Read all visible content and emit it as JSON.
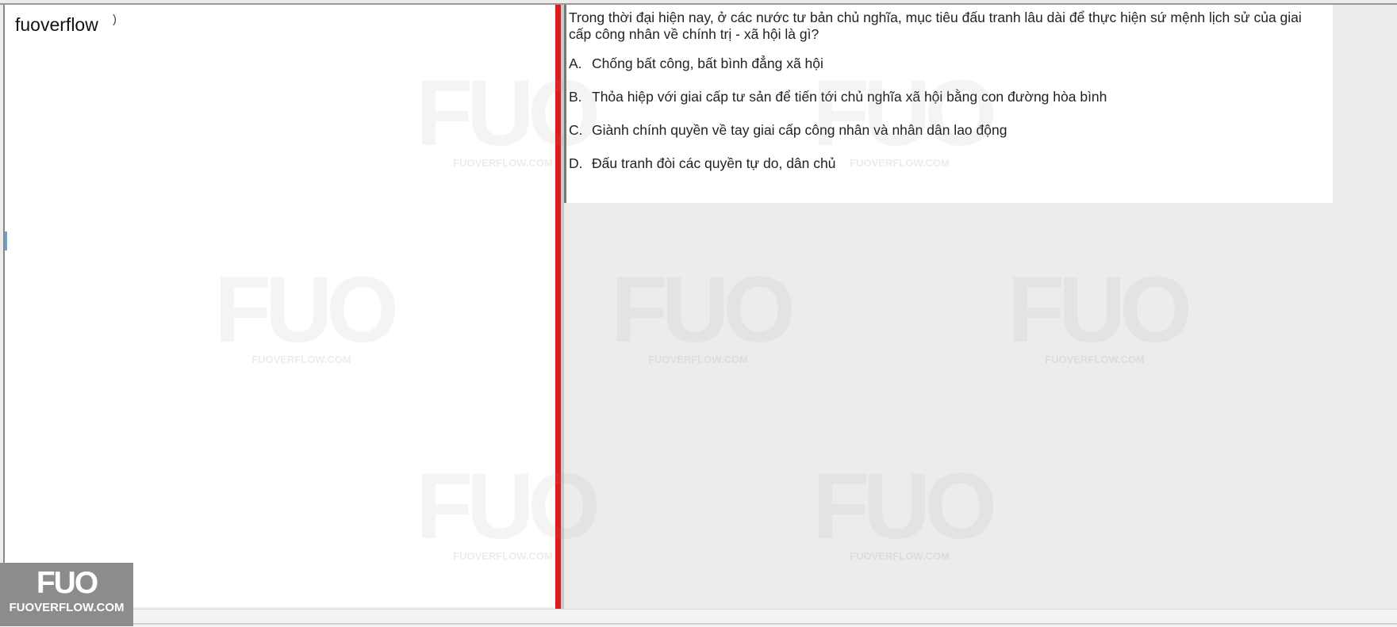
{
  "left_pane": {
    "title": "fuoverflow",
    "mark": ")"
  },
  "question": {
    "text": "Trong thời đại hiện nay, ở các nước tư bản chủ nghĩa, mục tiêu đấu tranh lâu dài để thực hiện sứ mệnh lịch sử của giai cấp công nhân về chính trị - xã hội là gì?",
    "options": [
      {
        "letter": "A.",
        "text": "Chống bất công, bất bình đẳng xã hội"
      },
      {
        "letter": "B.",
        "text": "Thỏa hiệp với giai cấp tư sản để tiến tới chủ nghĩa xã hội bằng con đường hòa bình"
      },
      {
        "letter": "C.",
        "text": "Giành chính quyền về tay giai cấp công nhân và nhân dân lao động"
      },
      {
        "letter": "D.",
        "text": "Đấu tranh đòi các quyền tự do, dân chủ"
      }
    ]
  },
  "watermark": {
    "logo_text": "FUO",
    "site_text": "FUOVERFLOW.COM"
  },
  "badge": {
    "logo_text": "FUO",
    "site_text": "FUOVERFLOW.COM"
  },
  "colors": {
    "divider": "#e01a1a",
    "badge_bg": "#8c8c8c"
  }
}
